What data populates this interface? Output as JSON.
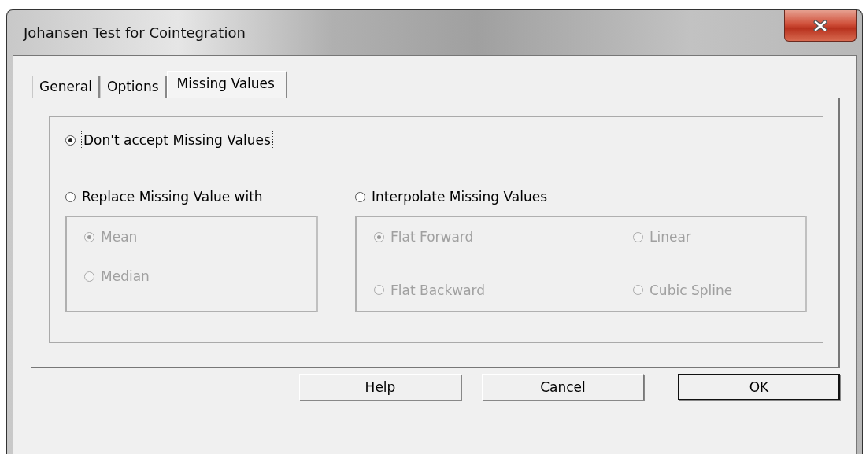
{
  "window": {
    "title": "Johansen Test for Cointegration"
  },
  "tabs": [
    {
      "label": "General",
      "selected": false
    },
    {
      "label": "Options",
      "selected": false
    },
    {
      "label": "Missing Values",
      "selected": true
    }
  ],
  "options": [
    {
      "label": "Don't accept Missing Values",
      "selected": true,
      "focused": true
    },
    {
      "label": "Replace Missing Value with",
      "selected": false,
      "focused": false,
      "kind": "list",
      "choices": [
        {
          "label": "Mean",
          "selected": true,
          "disabled": true
        },
        {
          "label": "Median",
          "selected": false,
          "disabled": true
        }
      ]
    },
    {
      "label": "Interpolate Missing Values",
      "selected": false,
      "focused": false,
      "kind": "grid",
      "choices": [
        {
          "label": "Flat Forward",
          "selected": true,
          "disabled": true
        },
        {
          "label": "Linear",
          "selected": false,
          "disabled": true
        },
        {
          "label": "Flat Backward",
          "selected": false,
          "disabled": true
        },
        {
          "label": "Cubic Spline",
          "selected": false,
          "disabled": true
        }
      ]
    }
  ],
  "buttons": [
    {
      "label": "Help",
      "default": false
    },
    {
      "label": "Cancel",
      "default": false
    },
    {
      "label": "OK",
      "default": true
    }
  ]
}
